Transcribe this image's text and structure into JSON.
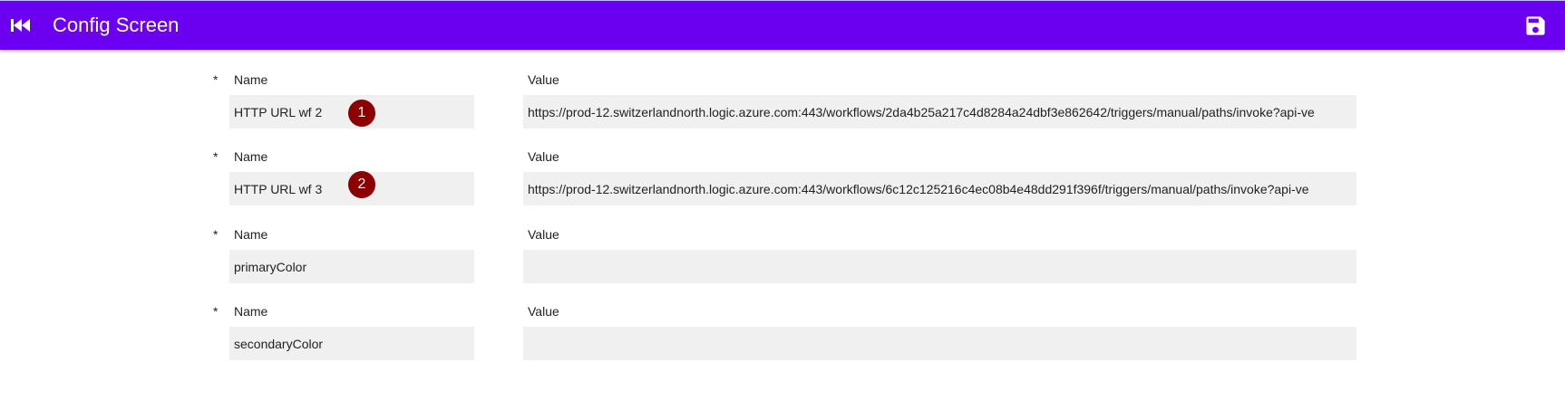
{
  "header": {
    "title": "Config Screen",
    "back_icon": "skip-previous-icon",
    "save_icon": "save-floppy-icon",
    "background_color": "#6a00ef"
  },
  "form": {
    "rows": [
      {
        "required_mark": "*",
        "name_label": "Name",
        "value_label": "Value",
        "name": "HTTP URL wf 2",
        "value": "https://prod-12.switzerlandnorth.logic.azure.com:443/workflows/2da4b25a217c4d8284a24dbf3e862642/triggers/manual/paths/invoke?api-ve",
        "badge": "1"
      },
      {
        "required_mark": "*",
        "name_label": "Name",
        "value_label": "Value",
        "name": "HTTP URL wf 3",
        "value": "https://prod-12.switzerlandnorth.logic.azure.com:443/workflows/6c12c125216c4ec08b4e48dd291f396f/triggers/manual/paths/invoke?api-ve",
        "badge": "2"
      },
      {
        "required_mark": "*",
        "name_label": "Name",
        "value_label": "Value",
        "name": "primaryColor",
        "value": ""
      },
      {
        "required_mark": "*",
        "name_label": "Name",
        "value_label": "Value",
        "name": "secondaryColor",
        "value": ""
      }
    ],
    "badge_color": "#8b0000"
  }
}
